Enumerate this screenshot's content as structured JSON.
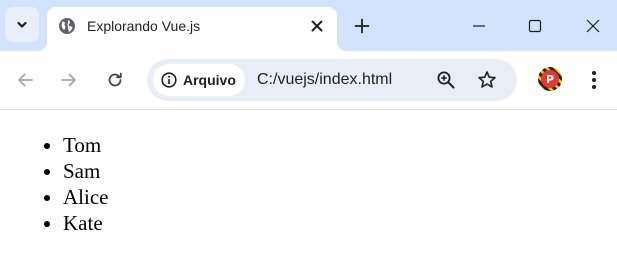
{
  "browser": {
    "tab": {
      "title": "Explorando Vue.js",
      "favicon": "globe-icon"
    },
    "address_bar": {
      "security_chip_label": "Arquivo",
      "security_icon": "info-icon",
      "url": "C:/vuejs/index.html"
    },
    "profile_initial": "P",
    "colors": {
      "tabstrip": "#d3e3fd",
      "omnibox": "#e9eef6",
      "profile_badge": "#e53935"
    }
  },
  "page": {
    "list_items": [
      "Tom",
      "Sam",
      "Alice",
      "Kate"
    ]
  }
}
